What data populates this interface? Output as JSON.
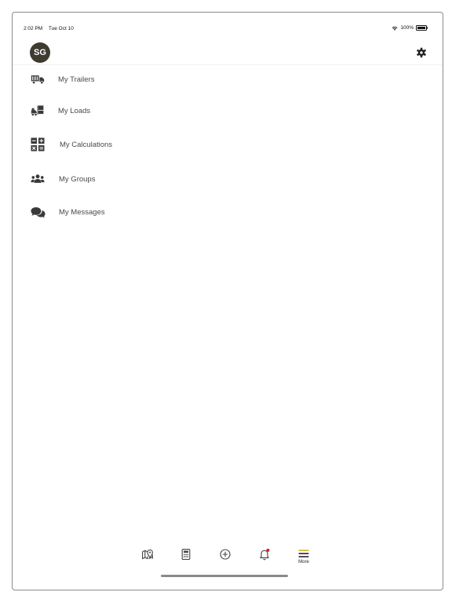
{
  "status": {
    "time": "2:02 PM",
    "date": "Tue Oct 10",
    "battery": "100%"
  },
  "profile": {
    "initials": "SG"
  },
  "menu": {
    "items": [
      {
        "label": "My Trailers",
        "icon": "truck-icon"
      },
      {
        "label": "My Loads",
        "icon": "forklift-icon"
      },
      {
        "label": "My Calculations",
        "icon": "calculator-icon"
      },
      {
        "label": "My Groups",
        "icon": "users-icon"
      },
      {
        "label": "My Messages",
        "icon": "comments-icon"
      }
    ]
  },
  "tabbar": {
    "items": [
      {
        "icon": "map-icon"
      },
      {
        "icon": "calculator-icon"
      },
      {
        "icon": "add-circle-icon"
      },
      {
        "icon": "bell-icon",
        "badge_color": "#e02020"
      },
      {
        "icon": "menu-icon",
        "label": "More",
        "active": true,
        "accent": "#d6a91c"
      }
    ]
  }
}
